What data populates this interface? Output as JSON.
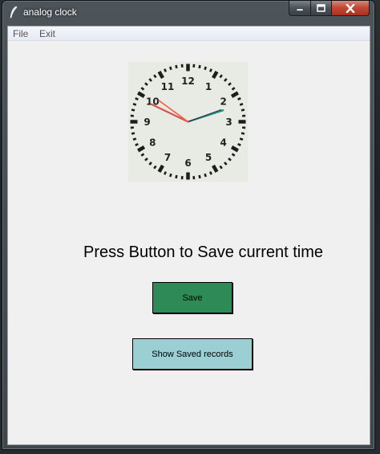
{
  "window": {
    "title": "analog clock",
    "controls": {
      "minimize": "minimize",
      "maximize": "maximize",
      "close": "close"
    }
  },
  "menu": {
    "items": [
      {
        "label": "File"
      },
      {
        "label": "Exit"
      }
    ]
  },
  "clock": {
    "numbers": [
      "12",
      "1",
      "2",
      "3",
      "4",
      "5",
      "6",
      "7",
      "8",
      "9",
      "10",
      "11"
    ],
    "hour_hand_color": "#d9534f",
    "minute_hand_color": "#f06040",
    "second_hand_color": "#1f8a8a",
    "time_shown": {
      "hour": 9,
      "minute": 51,
      "second": 12
    }
  },
  "main": {
    "headline": "Press Button to Save current time",
    "save_button": "Save",
    "show_button": "Show Saved records"
  },
  "colors": {
    "save_button": "#2e8b57",
    "show_button": "#9bcfd3",
    "client_bg": "#f0f0f0"
  }
}
